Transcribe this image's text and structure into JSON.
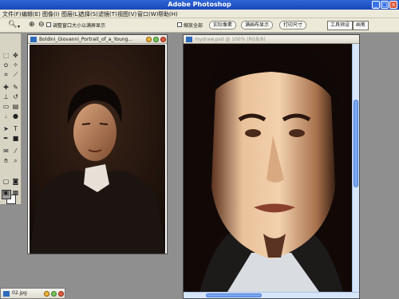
{
  "app": {
    "title": "Adobe Photoshop"
  },
  "window_controls": {
    "minimize": "_",
    "maximize": "□",
    "close": "×"
  },
  "menu": [
    {
      "id": "file",
      "label": "文件(F)"
    },
    {
      "id": "edit",
      "label": "编辑(E)"
    },
    {
      "id": "image",
      "label": "图像(I)"
    },
    {
      "id": "layer",
      "label": "图层(L)"
    },
    {
      "id": "select",
      "label": "选择(S)"
    },
    {
      "id": "filter",
      "label": "滤镜(T)"
    },
    {
      "id": "view",
      "label": "视图(V)"
    },
    {
      "id": "window",
      "label": "窗口(W)"
    },
    {
      "id": "help",
      "label": "帮助(H)"
    }
  ],
  "options_bar": {
    "resize_windows_label": "调整窗口大小以满屏显示",
    "zoom_all_label": "缩放全部",
    "actual_pixels_label": "实际像素",
    "fit_on_screen_label": "满画布显示",
    "print_size_label": "打印尺寸",
    "tool_presets_tab": "工具预设",
    "brushes_tab": "画笔"
  },
  "documents": {
    "reference": {
      "title": "Boldini_Giovanni_Portrait_of_a_Young..."
    },
    "painting": {
      "title": "mydraw.psd @ 100% (RGB/8)"
    }
  },
  "minimized": {
    "title": "02.jpg"
  },
  "colors": {
    "title_bar": "#2557d6",
    "menu_bg": "#ece9d8",
    "scroll_thumb": "#79a6f0"
  },
  "icons": [
    "zoom-icon",
    "hand-icon",
    "marquee-icon",
    "lasso-icon",
    "move-icon",
    "crop-icon",
    "brush-icon",
    "eraser-icon",
    "pen-icon",
    "type-icon"
  ]
}
